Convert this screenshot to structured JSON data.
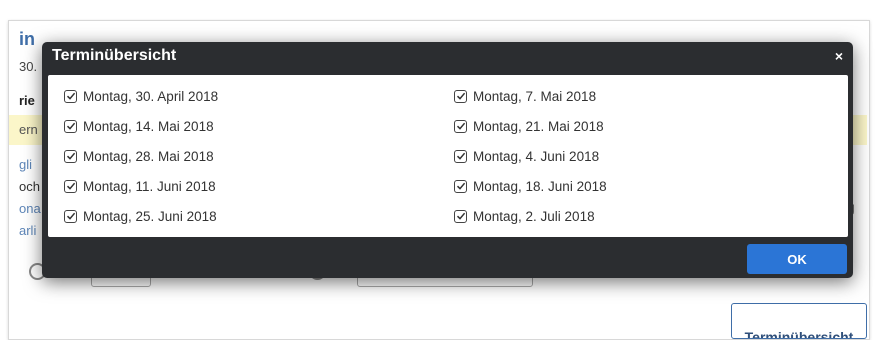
{
  "background": {
    "fragments": {
      "title": "in",
      "date": "30.",
      "bold": "rie",
      "yellow": "ern",
      "line1": "gli",
      "line2": "och",
      "line3": "ona",
      "line4": "arli",
      "right": "g"
    },
    "terminuebersicht_button": "Terminübersicht"
  },
  "modal": {
    "title": "Terminübersicht",
    "close": "×",
    "left_column": [
      {
        "label": "Montag, 30. April 2018",
        "checked": true
      },
      {
        "label": "Montag, 14. Mai 2018",
        "checked": true
      },
      {
        "label": "Montag, 28. Mai 2018",
        "checked": true
      },
      {
        "label": "Montag, 11. Juni 2018",
        "checked": true
      },
      {
        "label": "Montag, 25. Juni 2018",
        "checked": true
      }
    ],
    "right_column": [
      {
        "label": "Montag, 7. Mai 2018",
        "checked": true
      },
      {
        "label": "Montag, 21. Mai 2018",
        "checked": true
      },
      {
        "label": "Montag, 4. Juni 2018",
        "checked": true
      },
      {
        "label": "Montag, 18. Juni 2018",
        "checked": true
      },
      {
        "label": "Montag, 2. Juli 2018",
        "checked": true
      }
    ],
    "ok_label": "OK"
  }
}
